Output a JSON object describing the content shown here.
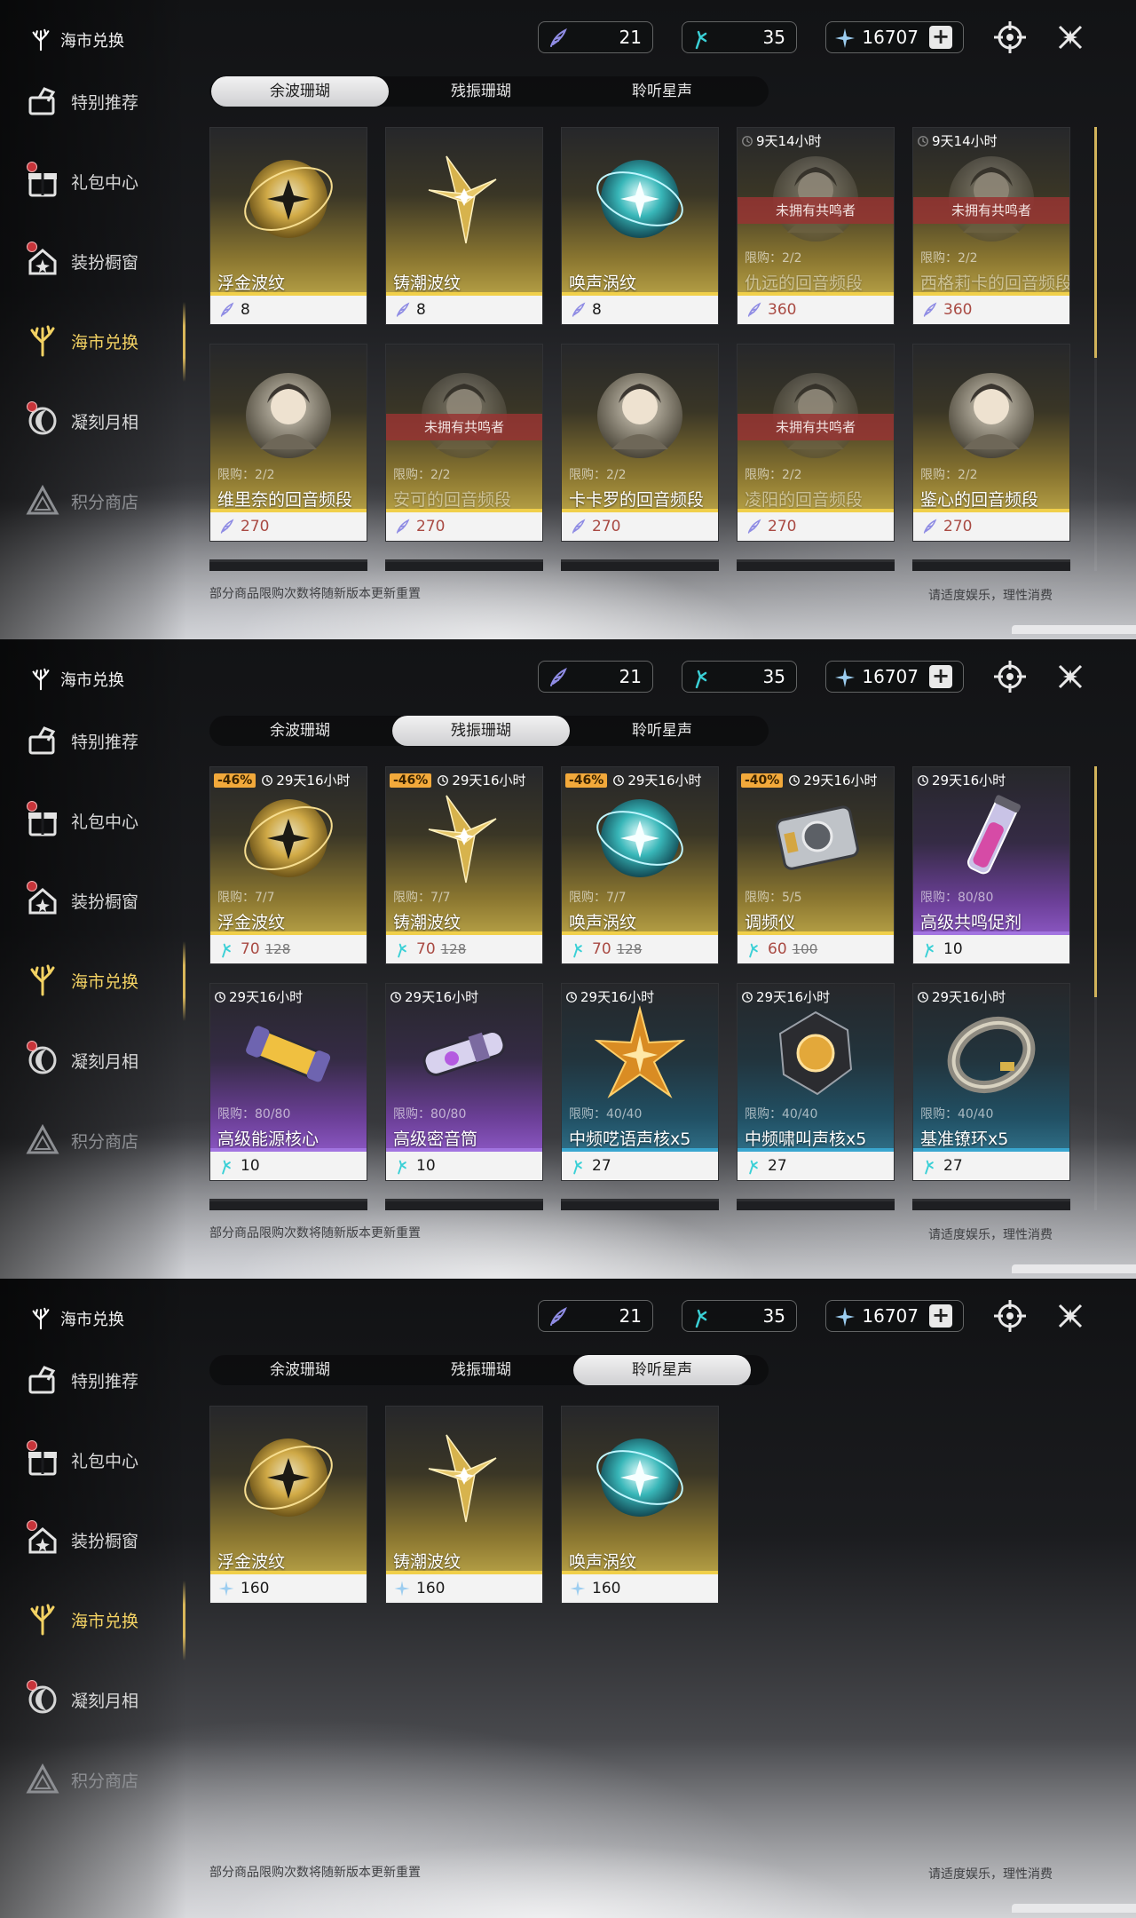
{
  "sidebar": {
    "brand": "海市兑换",
    "items": [
      {
        "label": "特别推荐",
        "icon": "tag-box-icon"
      },
      {
        "label": "礼包中心",
        "icon": "gift-icon"
      },
      {
        "label": "装扮橱窗",
        "icon": "house-star-icon"
      },
      {
        "label": "海市兑换",
        "icon": "coral-icon"
      },
      {
        "label": "凝刻月相",
        "icon": "moon-icon"
      },
      {
        "label": "积分商店",
        "icon": "triangle-icon"
      }
    ]
  },
  "currency": {
    "coral_a": "21",
    "coral_b": "35",
    "lunite": "16707",
    "plus": "+"
  },
  "tabs": [
    "余波珊瑚",
    "残振珊瑚",
    "聆听星声"
  ],
  "footer": {
    "left": "部分商品限购次数将随新版本更新重置",
    "right": "请适度娱乐，理性消费"
  },
  "colors": {
    "accent": "#f3d263",
    "gold": "#f0cf4a",
    "purple": "#a274e0",
    "blue": "#3aa6cf",
    "price_red": "#a94a43",
    "discount": "#f2a93b"
  },
  "panel1": {
    "cards": [
      {
        "title": "浮金波纹",
        "price": "8",
        "icon": "golden-orb-icon"
      },
      {
        "title": "铸潮波纹",
        "price": "8",
        "icon": "golden-blade-icon"
      },
      {
        "title": "唤声涡纹",
        "price": "8",
        "icon": "teal-orb-icon"
      },
      {
        "title": "仇远的回音频段",
        "price": "360",
        "timer": "9天14小时",
        "banner": "未拥有共鸣者",
        "limit": "限购：2/2",
        "icon": "portrait-icon"
      },
      {
        "title": "西格莉卡的回音频段",
        "price": "360",
        "timer": "9天14小时",
        "banner": "未拥有共鸣者",
        "limit": "限购：2/2",
        "icon": "portrait-icon"
      },
      {
        "title": "维里奈的回音频段",
        "price": "270",
        "limit": "限购：2/2",
        "icon": "portrait-icon"
      },
      {
        "title": "安可的回音频段",
        "price": "270",
        "banner": "未拥有共鸣者",
        "limit": "限购：2/2",
        "icon": "portrait-icon"
      },
      {
        "title": "卡卡罗的回音频段",
        "price": "270",
        "limit": "限购：2/2",
        "icon": "portrait-icon"
      },
      {
        "title": "凌阳的回音频段",
        "price": "270",
        "banner": "未拥有共鸣者",
        "limit": "限购：2/2",
        "icon": "portrait-icon"
      },
      {
        "title": "鉴心的回音频段",
        "price": "270",
        "limit": "限购：2/2",
        "icon": "portrait-icon"
      }
    ]
  },
  "panel2": {
    "cards": [
      {
        "title": "浮金波纹",
        "price": "70",
        "old": "128",
        "disc": "-46%",
        "timer": "29天16小时",
        "limit": "限购：7/7",
        "icon": "golden-orb-icon"
      },
      {
        "title": "铸潮波纹",
        "price": "70",
        "old": "128",
        "disc": "-46%",
        "timer": "29天16小时",
        "limit": "限购：7/7",
        "icon": "golden-blade-icon"
      },
      {
        "title": "唤声涡纹",
        "price": "70",
        "old": "128",
        "disc": "-46%",
        "timer": "29天16小时",
        "limit": "限购：7/7",
        "icon": "teal-orb-icon"
      },
      {
        "title": "调频仪",
        "price": "60",
        "old": "100",
        "disc": "-40%",
        "timer": "29天16小时",
        "limit": "限购：5/5",
        "icon": "tuner-device-icon"
      },
      {
        "title": "高级共鸣促剂",
        "price": "10",
        "timer": "29天16小时",
        "limit": "限购：80/80",
        "icon": "vial-icon"
      },
      {
        "title": "高级能源核心",
        "price": "10",
        "timer": "29天16小时",
        "limit": "限购：80/80",
        "icon": "energy-core-icon"
      },
      {
        "title": "高级密音筒",
        "price": "10",
        "timer": "29天16小时",
        "limit": "限购：80/80",
        "icon": "sealed-tube-icon"
      },
      {
        "title": "中频呓语声核x5",
        "price": "27",
        "timer": "29天16小时",
        "limit": "限购：40/40",
        "icon": "star-core-icon"
      },
      {
        "title": "中频啸叫声核x5",
        "price": "27",
        "timer": "29天16小时",
        "limit": "限购：40/40",
        "icon": "dark-core-icon"
      },
      {
        "title": "基准镣环x5",
        "price": "27",
        "timer": "29天16小时",
        "limit": "限购：40/40",
        "icon": "ring-icon"
      }
    ]
  },
  "panel3": {
    "cards": [
      {
        "title": "浮金波纹",
        "price": "160",
        "icon": "golden-orb-icon"
      },
      {
        "title": "铸潮波纹",
        "price": "160",
        "icon": "golden-blade-icon"
      },
      {
        "title": "唤声涡纹",
        "price": "160",
        "icon": "teal-orb-icon"
      }
    ]
  }
}
